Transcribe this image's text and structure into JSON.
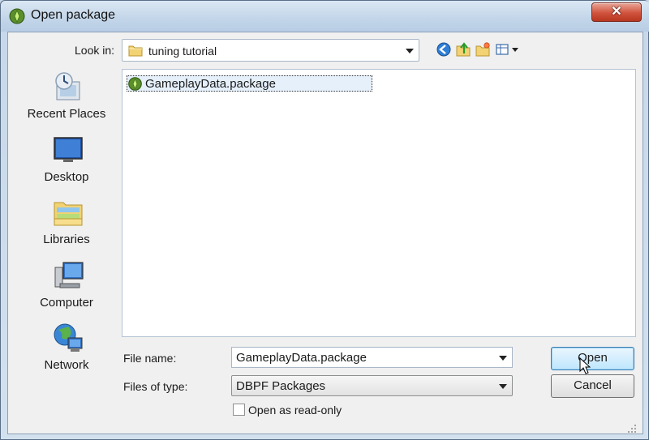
{
  "window": {
    "title": "Open package",
    "close_glyph": "✕"
  },
  "toolbar": {
    "look_in_label": "Look in:",
    "look_in_value": "tuning tutorial",
    "icons": [
      "back-icon",
      "up-folder-icon",
      "new-folder-icon",
      "view-menu-icon"
    ]
  },
  "places": [
    {
      "label": "Recent Places",
      "icon": "recent-places-icon"
    },
    {
      "label": "Desktop",
      "icon": "desktop-icon"
    },
    {
      "label": "Libraries",
      "icon": "libraries-icon"
    },
    {
      "label": "Computer",
      "icon": "computer-icon"
    },
    {
      "label": "Network",
      "icon": "network-icon"
    }
  ],
  "files": [
    {
      "name": "GameplayData.package",
      "selected": true
    }
  ],
  "form": {
    "file_name_label": "File name:",
    "file_name_value": "GameplayData.package",
    "file_type_label": "Files of type:",
    "file_type_value": "DBPF Packages",
    "read_only_label": "Open as read-only",
    "read_only_checked": false
  },
  "buttons": {
    "open": "Open",
    "cancel": "Cancel"
  },
  "colors": {
    "accent": "#3c7fb1",
    "close": "#d0533d",
    "selection": "#e5f0fb"
  }
}
